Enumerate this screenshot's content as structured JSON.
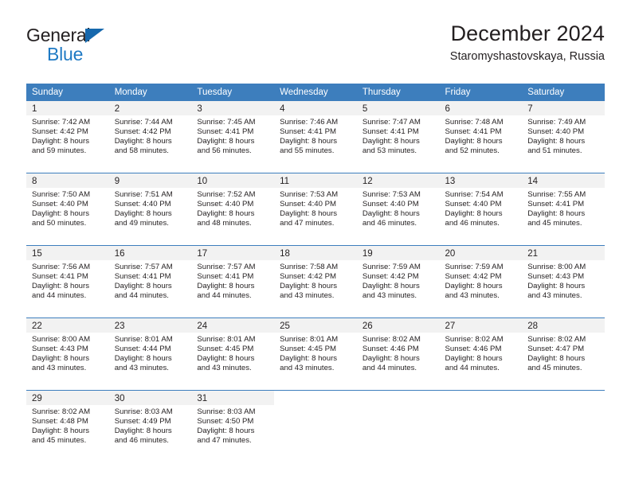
{
  "brand": {
    "name_part1": "General",
    "name_part2": "Blue",
    "triangle_icon": "triangle-icon",
    "accent_color": "#1f7ac4"
  },
  "header": {
    "title": "December 2024",
    "subtitle": "Staromyshastovskaya, Russia"
  },
  "calendar": {
    "header_bg": "#3d7ebd",
    "daynum_bg": "#f2f2f2",
    "weekdays": [
      "Sunday",
      "Monday",
      "Tuesday",
      "Wednesday",
      "Thursday",
      "Friday",
      "Saturday"
    ],
    "weeks": [
      [
        {
          "day": "1",
          "sunrise": "Sunrise: 7:42 AM",
          "sunset": "Sunset: 4:42 PM",
          "daylight_line1": "Daylight: 8 hours",
          "daylight_line2": "and 59 minutes."
        },
        {
          "day": "2",
          "sunrise": "Sunrise: 7:44 AM",
          "sunset": "Sunset: 4:42 PM",
          "daylight_line1": "Daylight: 8 hours",
          "daylight_line2": "and 58 minutes."
        },
        {
          "day": "3",
          "sunrise": "Sunrise: 7:45 AM",
          "sunset": "Sunset: 4:41 PM",
          "daylight_line1": "Daylight: 8 hours",
          "daylight_line2": "and 56 minutes."
        },
        {
          "day": "4",
          "sunrise": "Sunrise: 7:46 AM",
          "sunset": "Sunset: 4:41 PM",
          "daylight_line1": "Daylight: 8 hours",
          "daylight_line2": "and 55 minutes."
        },
        {
          "day": "5",
          "sunrise": "Sunrise: 7:47 AM",
          "sunset": "Sunset: 4:41 PM",
          "daylight_line1": "Daylight: 8 hours",
          "daylight_line2": "and 53 minutes."
        },
        {
          "day": "6",
          "sunrise": "Sunrise: 7:48 AM",
          "sunset": "Sunset: 4:41 PM",
          "daylight_line1": "Daylight: 8 hours",
          "daylight_line2": "and 52 minutes."
        },
        {
          "day": "7",
          "sunrise": "Sunrise: 7:49 AM",
          "sunset": "Sunset: 4:40 PM",
          "daylight_line1": "Daylight: 8 hours",
          "daylight_line2": "and 51 minutes."
        }
      ],
      [
        {
          "day": "8",
          "sunrise": "Sunrise: 7:50 AM",
          "sunset": "Sunset: 4:40 PM",
          "daylight_line1": "Daylight: 8 hours",
          "daylight_line2": "and 50 minutes."
        },
        {
          "day": "9",
          "sunrise": "Sunrise: 7:51 AM",
          "sunset": "Sunset: 4:40 PM",
          "daylight_line1": "Daylight: 8 hours",
          "daylight_line2": "and 49 minutes."
        },
        {
          "day": "10",
          "sunrise": "Sunrise: 7:52 AM",
          "sunset": "Sunset: 4:40 PM",
          "daylight_line1": "Daylight: 8 hours",
          "daylight_line2": "and 48 minutes."
        },
        {
          "day": "11",
          "sunrise": "Sunrise: 7:53 AM",
          "sunset": "Sunset: 4:40 PM",
          "daylight_line1": "Daylight: 8 hours",
          "daylight_line2": "and 47 minutes."
        },
        {
          "day": "12",
          "sunrise": "Sunrise: 7:53 AM",
          "sunset": "Sunset: 4:40 PM",
          "daylight_line1": "Daylight: 8 hours",
          "daylight_line2": "and 46 minutes."
        },
        {
          "day": "13",
          "sunrise": "Sunrise: 7:54 AM",
          "sunset": "Sunset: 4:40 PM",
          "daylight_line1": "Daylight: 8 hours",
          "daylight_line2": "and 46 minutes."
        },
        {
          "day": "14",
          "sunrise": "Sunrise: 7:55 AM",
          "sunset": "Sunset: 4:41 PM",
          "daylight_line1": "Daylight: 8 hours",
          "daylight_line2": "and 45 minutes."
        }
      ],
      [
        {
          "day": "15",
          "sunrise": "Sunrise: 7:56 AM",
          "sunset": "Sunset: 4:41 PM",
          "daylight_line1": "Daylight: 8 hours",
          "daylight_line2": "and 44 minutes."
        },
        {
          "day": "16",
          "sunrise": "Sunrise: 7:57 AM",
          "sunset": "Sunset: 4:41 PM",
          "daylight_line1": "Daylight: 8 hours",
          "daylight_line2": "and 44 minutes."
        },
        {
          "day": "17",
          "sunrise": "Sunrise: 7:57 AM",
          "sunset": "Sunset: 4:41 PM",
          "daylight_line1": "Daylight: 8 hours",
          "daylight_line2": "and 44 minutes."
        },
        {
          "day": "18",
          "sunrise": "Sunrise: 7:58 AM",
          "sunset": "Sunset: 4:42 PM",
          "daylight_line1": "Daylight: 8 hours",
          "daylight_line2": "and 43 minutes."
        },
        {
          "day": "19",
          "sunrise": "Sunrise: 7:59 AM",
          "sunset": "Sunset: 4:42 PM",
          "daylight_line1": "Daylight: 8 hours",
          "daylight_line2": "and 43 minutes."
        },
        {
          "day": "20",
          "sunrise": "Sunrise: 7:59 AM",
          "sunset": "Sunset: 4:42 PM",
          "daylight_line1": "Daylight: 8 hours",
          "daylight_line2": "and 43 minutes."
        },
        {
          "day": "21",
          "sunrise": "Sunrise: 8:00 AM",
          "sunset": "Sunset: 4:43 PM",
          "daylight_line1": "Daylight: 8 hours",
          "daylight_line2": "and 43 minutes."
        }
      ],
      [
        {
          "day": "22",
          "sunrise": "Sunrise: 8:00 AM",
          "sunset": "Sunset: 4:43 PM",
          "daylight_line1": "Daylight: 8 hours",
          "daylight_line2": "and 43 minutes."
        },
        {
          "day": "23",
          "sunrise": "Sunrise: 8:01 AM",
          "sunset": "Sunset: 4:44 PM",
          "daylight_line1": "Daylight: 8 hours",
          "daylight_line2": "and 43 minutes."
        },
        {
          "day": "24",
          "sunrise": "Sunrise: 8:01 AM",
          "sunset": "Sunset: 4:45 PM",
          "daylight_line1": "Daylight: 8 hours",
          "daylight_line2": "and 43 minutes."
        },
        {
          "day": "25",
          "sunrise": "Sunrise: 8:01 AM",
          "sunset": "Sunset: 4:45 PM",
          "daylight_line1": "Daylight: 8 hours",
          "daylight_line2": "and 43 minutes."
        },
        {
          "day": "26",
          "sunrise": "Sunrise: 8:02 AM",
          "sunset": "Sunset: 4:46 PM",
          "daylight_line1": "Daylight: 8 hours",
          "daylight_line2": "and 44 minutes."
        },
        {
          "day": "27",
          "sunrise": "Sunrise: 8:02 AM",
          "sunset": "Sunset: 4:46 PM",
          "daylight_line1": "Daylight: 8 hours",
          "daylight_line2": "and 44 minutes."
        },
        {
          "day": "28",
          "sunrise": "Sunrise: 8:02 AM",
          "sunset": "Sunset: 4:47 PM",
          "daylight_line1": "Daylight: 8 hours",
          "daylight_line2": "and 45 minutes."
        }
      ],
      [
        {
          "day": "29",
          "sunrise": "Sunrise: 8:02 AM",
          "sunset": "Sunset: 4:48 PM",
          "daylight_line1": "Daylight: 8 hours",
          "daylight_line2": "and 45 minutes."
        },
        {
          "day": "30",
          "sunrise": "Sunrise: 8:03 AM",
          "sunset": "Sunset: 4:49 PM",
          "daylight_line1": "Daylight: 8 hours",
          "daylight_line2": "and 46 minutes."
        },
        {
          "day": "31",
          "sunrise": "Sunrise: 8:03 AM",
          "sunset": "Sunset: 4:50 PM",
          "daylight_line1": "Daylight: 8 hours",
          "daylight_line2": "and 47 minutes."
        },
        {
          "day": "",
          "sunrise": "",
          "sunset": "",
          "daylight_line1": "",
          "daylight_line2": ""
        },
        {
          "day": "",
          "sunrise": "",
          "sunset": "",
          "daylight_line1": "",
          "daylight_line2": ""
        },
        {
          "day": "",
          "sunrise": "",
          "sunset": "",
          "daylight_line1": "",
          "daylight_line2": ""
        },
        {
          "day": "",
          "sunrise": "",
          "sunset": "",
          "daylight_line1": "",
          "daylight_line2": ""
        }
      ]
    ]
  }
}
